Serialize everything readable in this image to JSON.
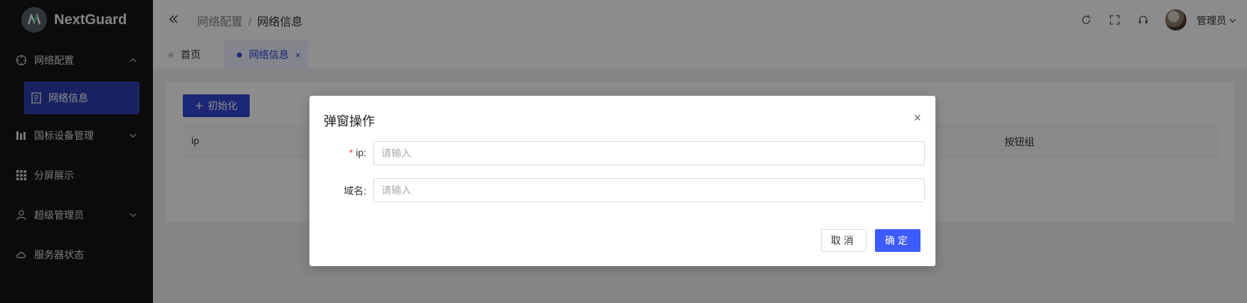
{
  "app": {
    "name": "NextGuard"
  },
  "sidebar": {
    "items": [
      {
        "label": "网络配置",
        "icon": "crosshair-icon",
        "chevron": "up"
      },
      {
        "label": "网络信息",
        "icon": "document-icon",
        "active": true
      },
      {
        "label": "国标设备管理",
        "icon": "chart-bars-icon",
        "chevron": "down"
      },
      {
        "label": "分屏展示",
        "icon": "grid-icon"
      },
      {
        "label": "超级管理员",
        "icon": "user-icon",
        "chevron": "down"
      },
      {
        "label": "服务器状态",
        "icon": "cloud-icon"
      }
    ]
  },
  "header": {
    "breadcrumb": [
      "网络配置",
      "网络信息"
    ],
    "separator": "/",
    "user": "管理员"
  },
  "tabs": [
    {
      "label": "首页",
      "active": false
    },
    {
      "label": "网络信息",
      "active": true,
      "close": "×"
    }
  ],
  "content": {
    "init_button": "初始化",
    "table_headers": [
      "ip",
      "按钮组"
    ]
  },
  "modal": {
    "title": "弹窗操作",
    "close": "×",
    "fields": [
      {
        "label": "ip:",
        "required": true,
        "placeholder": "请输入",
        "value": ""
      },
      {
        "label": "域名:",
        "required": false,
        "placeholder": "请输入",
        "value": ""
      }
    ],
    "cancel": "取消",
    "confirm": "确定"
  },
  "colors": {
    "primary": "#3247d4",
    "confirm": "#3d5afe",
    "sidebar_bg": "#141414",
    "required": "#e23c3c"
  }
}
